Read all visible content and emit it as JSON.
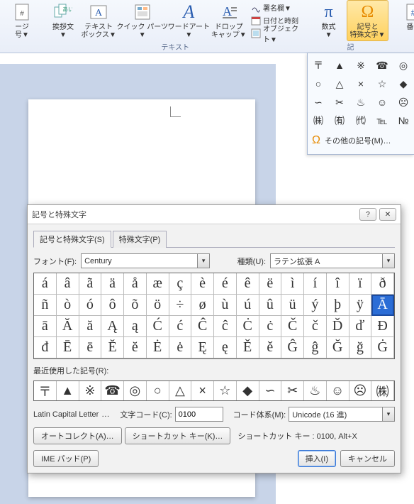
{
  "ribbon": {
    "page_btn": "ージ\n号▼",
    "aisatsu": "挨拶文\n▼",
    "textbox": "テキスト\nボックス▼",
    "quickparts": "クイック パーツ\n▼",
    "wordart": "ワードアート\n▼",
    "dropcap": "ドロップ\nキャップ▼",
    "signature": "署名欄▼",
    "datetime": "日付と時刻",
    "object": "オブジェクト▼",
    "equation": "数式\n▼",
    "symbol": "記号と\n特殊文字▼",
    "number": "番号",
    "group_text": "テキスト",
    "group_sym": "記"
  },
  "panel": {
    "rows": [
      [
        "〒",
        "▲",
        "※",
        "☎",
        "◎"
      ],
      [
        "○",
        "△",
        "×",
        "☆",
        "◆"
      ],
      [
        "∽",
        "✂",
        "♨",
        "☺",
        "☹"
      ],
      [
        "㈱",
        "㈲",
        "㈹",
        "℡",
        "№"
      ]
    ],
    "more": "その他の記号(M)…"
  },
  "dialog": {
    "title": "記号と特殊文字",
    "tab1": "記号と特殊文字(S)",
    "tab2": "特殊文字(P)",
    "font_label": "フォント(F):",
    "font_value": "Century",
    "subset_label": "種類(U):",
    "subset_value": "ラテン拡張 A",
    "grid": [
      "á",
      "â",
      "ã",
      "ä",
      "å",
      "æ",
      "ç",
      "è",
      "é",
      "ê",
      "ë",
      "ì",
      "í",
      "î",
      "ï",
      "ð",
      "ñ",
      "ò",
      "ó",
      "ô",
      "õ",
      "ö",
      "÷",
      "ø",
      "ù",
      "ú",
      "û",
      "ü",
      "ý",
      "þ",
      "ÿ",
      "Ā",
      "ā",
      "Ă",
      "ă",
      "Ą",
      "ą",
      "Ć",
      "ć",
      "Ĉ",
      "ĉ",
      "Ċ",
      "ċ",
      "Č",
      "č",
      "Ď",
      "ď",
      "Đ",
      "đ",
      "Ē",
      "ē",
      "Ĕ",
      "ĕ",
      "Ė",
      "ė",
      "Ę",
      "ę",
      "Ě",
      "ě",
      "Ĝ",
      "ĝ",
      "Ğ",
      "ğ",
      "Ġ"
    ],
    "selected_index": 31,
    "recent_label": "最近使用した記号(R):",
    "recent": [
      "〒",
      "▲",
      "※",
      "☎",
      "◎",
      "○",
      "△",
      "×",
      "☆",
      "◆",
      "∽",
      "✂",
      "♨",
      "☺",
      "☹",
      "㈱"
    ],
    "char_name": "Latin Capital Letter",
    "code_label": "文字コード(C):",
    "code_value": "0100",
    "system_label": "コード体系(M):",
    "system_value": "Unicode (16 進)",
    "autocorrect": "オートコレクト(A)…",
    "shortcutkey_btn": "ショートカット キー(K)…",
    "shortcut_text": "ショートカット キー : 0100, Alt+X",
    "ime": "IME パッド(P)",
    "insert": "挿入(I)",
    "cancel": "キャンセル"
  }
}
